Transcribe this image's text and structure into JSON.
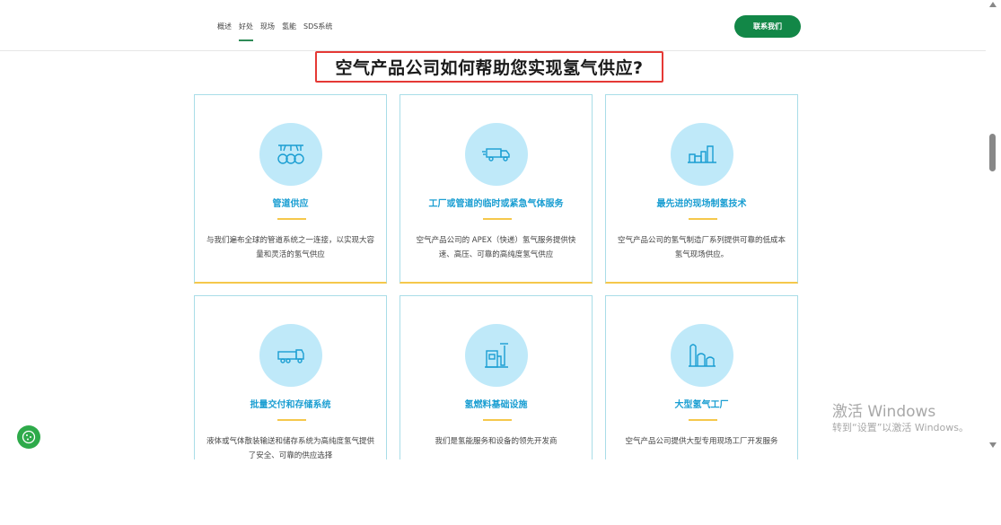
{
  "nav": {
    "items": [
      "概述",
      "好处",
      "现场",
      "氢能",
      "SDS系统"
    ],
    "active_index": 1,
    "contact_label": "联系我们"
  },
  "main": {
    "title": "空气产品公司如何帮助您实现氢气供应?"
  },
  "cards": [
    {
      "icon": "pipeline-icon",
      "title": "管道供应",
      "desc": "与我们遍布全球的管道系统之一连接，以实现大容量和灵活的氢气供应"
    },
    {
      "icon": "truck-icon",
      "title": "工厂或管道的临时或紧急气体服务",
      "desc": "空气产品公司的 APEX（快递）氢气服务提供快速、高压、可靠的高纯度氢气供应"
    },
    {
      "icon": "factory-icon",
      "title": "最先进的现场制氢技术",
      "desc": "空气产品公司的氢气制造厂系列提供可靠的低成本氢气现场供应。"
    },
    {
      "icon": "tanker-truck-icon",
      "title": "批量交付和存储系统",
      "desc": "液体或气体散装输送和储存系统为高纯度氢气提供了安全、可靠的供应选择"
    },
    {
      "icon": "fuel-station-icon",
      "title": "氢燃料基础设施",
      "desc": "我们是氢能服务和设备的领先开发商"
    },
    {
      "icon": "large-plant-icon",
      "title": "大型氢气工厂",
      "desc": "空气产品公司提供大型专用现场工厂开发服务"
    }
  ],
  "watermark": {
    "line1": "激活 Windows",
    "line2": "转到“设置”以激活 Windows。"
  },
  "colors": {
    "accent_green": "#128747",
    "card_title_blue": "#1a9ed2",
    "icon_circle": "#bfe9f9",
    "highlight_red": "#e53935",
    "accent_yellow": "#f5c84b"
  }
}
